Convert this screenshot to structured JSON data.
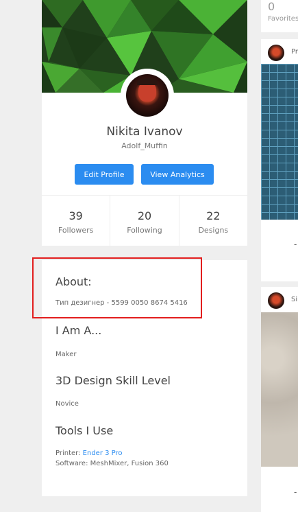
{
  "profile": {
    "name": "Nikita Ivanov",
    "username": "Adolf_Muffin",
    "buttons": {
      "edit": "Edit Profile",
      "analytics": "View Analytics"
    },
    "stats": [
      {
        "value": "39",
        "label": "Followers"
      },
      {
        "value": "20",
        "label": "Following"
      },
      {
        "value": "22",
        "label": "Designs"
      }
    ]
  },
  "about": {
    "title": "About:",
    "text": "Тип дезигнер - 5599 0050 8674 5416",
    "i_am_title": "I Am A...",
    "i_am_value": "Maker",
    "skill_title": "3D Design Skill Level",
    "skill_value": "Novice",
    "tools_title": "Tools I Use",
    "printer_label": "Printer:",
    "printer_value": "Ender 3 Pro",
    "software_label": "Software:",
    "software_value": "MeshMixer,  Fusion 360"
  },
  "right_panel": {
    "favorites_count": "0",
    "favorites_label": "Favorites",
    "feed": [
      {
        "user": "Pr"
      },
      {
        "user": "Si"
      }
    ]
  },
  "colors": {
    "accent": "#2b8cf0",
    "highlight": "#e21e1e"
  }
}
